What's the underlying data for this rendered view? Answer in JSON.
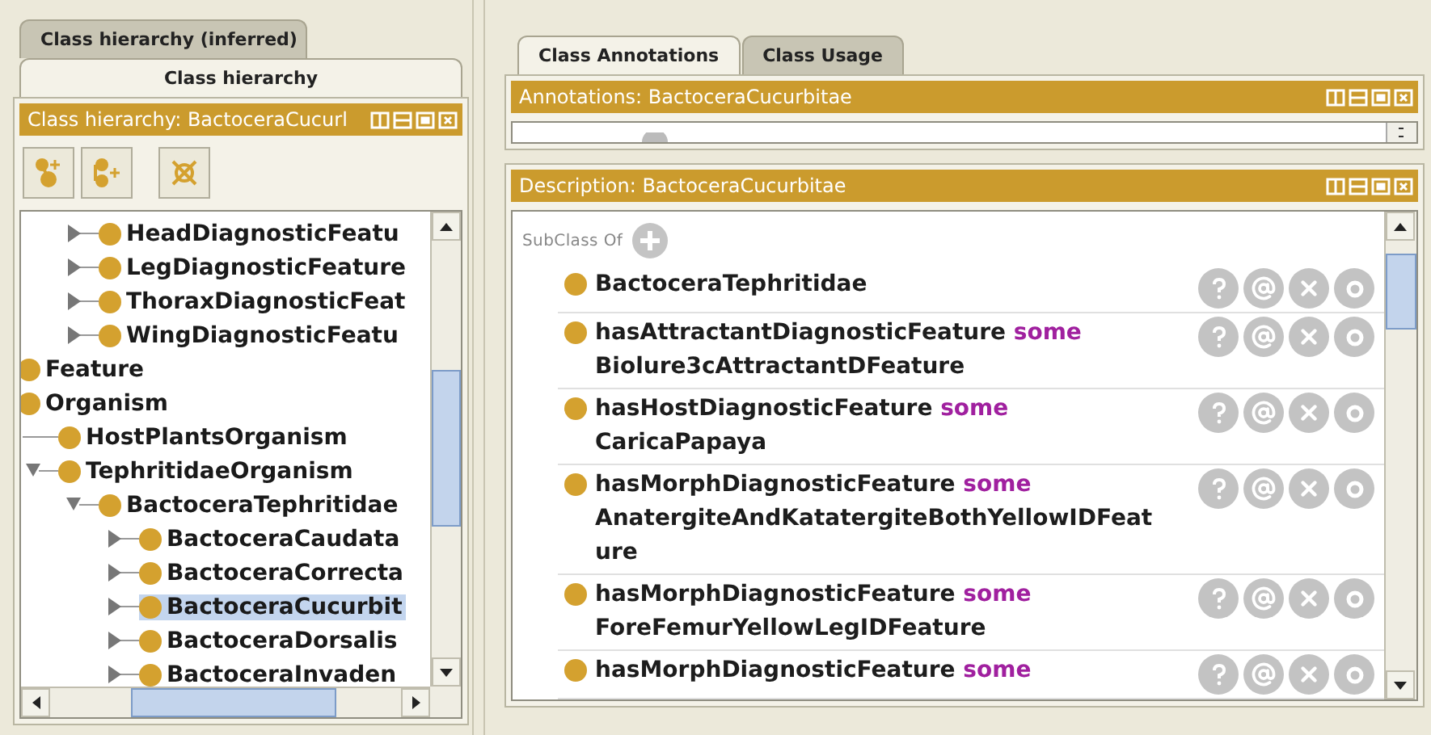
{
  "left_tabs": [
    {
      "label": "Class hierarchy (inferred)",
      "selected": false
    },
    {
      "label": "Class hierarchy",
      "selected": true
    }
  ],
  "hierarchy_view": {
    "title": "Class hierarchy: BactoceraCucurl",
    "tree": {
      "scrolled_branch": [
        {
          "label": "HeadDiagnosticFeatu",
          "expanded": false,
          "selected": false
        },
        {
          "label": "LegDiagnosticFeature",
          "expanded": false,
          "selected": false
        },
        {
          "label": "ThoraxDiagnosticFeat",
          "expanded": false,
          "selected": false
        },
        {
          "label": "WingDiagnosticFeatu",
          "expanded": false,
          "selected": false
        }
      ],
      "roots": [
        {
          "label": "Feature",
          "selected": false
        },
        {
          "label": "Organism",
          "selected": false,
          "children": [
            {
              "label": "HostPlantsOrganism",
              "selected": false
            },
            {
              "label": "TephritidaeOrganism",
              "expanded": true,
              "selected": false,
              "children": [
                {
                  "label": "BactoceraTephritidae",
                  "expanded": true,
                  "selected": false,
                  "children": [
                    {
                      "label": "BactoceraCaudata",
                      "expanded": false,
                      "selected": false
                    },
                    {
                      "label": "BactoceraCorrecta",
                      "expanded": false,
                      "selected": false
                    },
                    {
                      "label": "BactoceraCucurbit",
                      "expanded": false,
                      "selected": true
                    },
                    {
                      "label": "BactoceraDorsalis",
                      "expanded": false,
                      "selected": false
                    },
                    {
                      "label": "BactoceraInvaden",
                      "expanded": false,
                      "selected": false
                    }
                  ]
                }
              ]
            }
          ]
        }
      ]
    }
  },
  "right_tabs": [
    {
      "label": "Class Annotations",
      "selected": true
    },
    {
      "label": "Class Usage",
      "selected": false
    }
  ],
  "annotations_view": {
    "title": "Annotations: BactoceraCucurbitae"
  },
  "description_view": {
    "title": "Description: BactoceraCucurbitae",
    "section": "SubClass Of",
    "entries": [
      {
        "kind": "class",
        "name": "BactoceraTephritidae"
      },
      {
        "kind": "restriction",
        "property": "hasAttractantDiagnosticFeature",
        "quantifier": "some",
        "filler": "Biolure3cAttractantDFeature"
      },
      {
        "kind": "restriction",
        "property": "hasHostDiagnosticFeature",
        "quantifier": "some",
        "filler": "CaricaPapaya"
      },
      {
        "kind": "restriction",
        "property": "hasMorphDiagnosticFeature",
        "quantifier": "some",
        "filler": "AnatergiteAndKatatergiteBothYellowIDFeature"
      },
      {
        "kind": "restriction",
        "property": "hasMorphDiagnosticFeature",
        "quantifier": "some",
        "filler": "ForeFemurYellowLegIDFeature"
      },
      {
        "kind": "restriction",
        "property": "hasMorphDiagnosticFeature",
        "quantifier": "some"
      }
    ]
  }
}
